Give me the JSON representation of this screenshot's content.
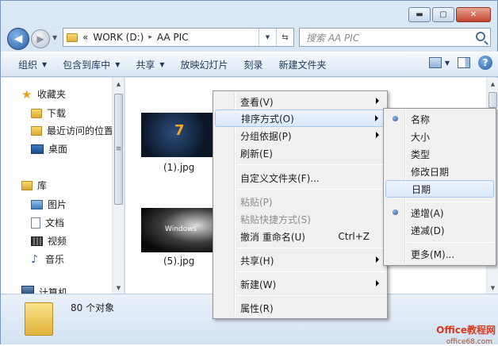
{
  "window": {
    "caption": {
      "minimize": "▬",
      "maximize": "▢",
      "close": "✕"
    }
  },
  "nav": {
    "back_glyph": "◀",
    "forward_glyph": "▶",
    "history_glyph": "▼"
  },
  "address": {
    "overflow": "«",
    "drive": "WORK (D:)",
    "separator": "▸",
    "folder": "AA PIC",
    "dropdown_glyph": "▼",
    "refresh_glyph": "⇆"
  },
  "search": {
    "placeholder": "搜索 AA PIC"
  },
  "toolbar": {
    "organize": "组织",
    "include_library": "包含到库中",
    "share": "共享",
    "slideshow": "放映幻灯片",
    "burn": "刻录",
    "new_folder": "新建文件夹",
    "dropdown_glyph": "▼",
    "help": "?"
  },
  "sidebar": {
    "favorites": "收藏夹",
    "downloads": "下载",
    "recent": "最近访问的位置",
    "desktop": "桌面",
    "libraries": "库",
    "pictures": "图片",
    "documents": "文档",
    "videos": "视频",
    "music": "音乐",
    "computer": "计算机",
    "star_glyph": "★",
    "music_glyph": "♪",
    "scroll_up": "▲",
    "scroll_down": "▼",
    "thumb_grip": "≡"
  },
  "files": [
    {
      "name": "(1).jpg"
    },
    {
      "name": "(5).jpg",
      "thumb_text": "Windows"
    }
  ],
  "content_scroll": {
    "up": "▲",
    "down": "▼"
  },
  "status": {
    "count": "80 个对象",
    "watermark": "Office教程网",
    "watermark_url": "office68.com"
  },
  "context_menu": {
    "view": "查看(V)",
    "sort_by": "排序方式(O)",
    "group_by": "分组依据(P)",
    "refresh": "刷新(E)",
    "customize": "自定义文件夹(F)...",
    "paste": "粘贴(P)",
    "paste_shortcut": "粘贴快捷方式(S)",
    "undo_rename": "撤消 重命名(U)",
    "undo_shortcut": "Ctrl+Z",
    "share": "共享(H)",
    "new": "新建(W)",
    "properties": "属性(R)"
  },
  "sort_menu": {
    "name": "名称",
    "size": "大小",
    "type": "类型",
    "date_modified": "修改日期",
    "date": "日期",
    "ascending": "递增(A)",
    "descending": "递减(D)",
    "more": "更多(M)..."
  }
}
